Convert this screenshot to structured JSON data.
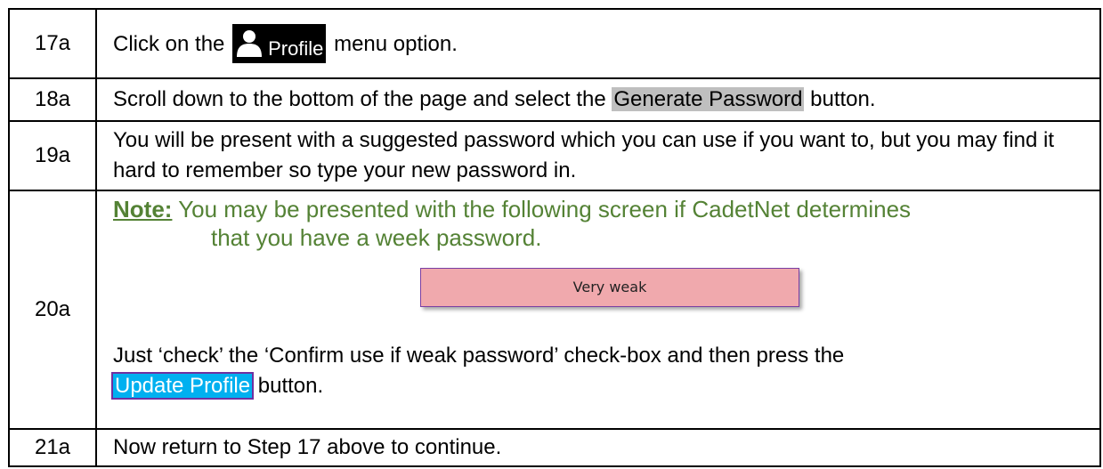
{
  "steps": [
    {
      "num": "17a",
      "text_before": "Click on the",
      "chip_label": "Profile",
      "text_after": "menu option."
    },
    {
      "num": "18a",
      "text_before": "Scroll down to the bottom of the page and select the",
      "button_label": "Generate Password",
      "text_after": "button."
    },
    {
      "num": "19a",
      "text": "You will be present with a suggested password which you can use if you want to, but you may find it hard to remember so type your new password in."
    },
    {
      "num": "20a",
      "note_label": "Note:",
      "note_line1": "You may be presented with the following screen if CadetNet determines",
      "note_line2": "that you have a week password.",
      "strength_label": "Very weak",
      "text_before": "Just ‘check’ the ‘Confirm use if weak password’ check-box and then press the",
      "button_label": "Update Profile",
      "text_after": "button."
    },
    {
      "num": "21a",
      "text": "Now return to Step 17 above to continue."
    }
  ],
  "colors": {
    "note_green": "#548235",
    "generate_button_bg": "#bfbfbf",
    "update_button_bg": "#00b0f0",
    "update_button_outline": "#7030a0",
    "strength_bar_bg": "#f0a9ad"
  },
  "icons": {
    "profile": "person-icon"
  }
}
